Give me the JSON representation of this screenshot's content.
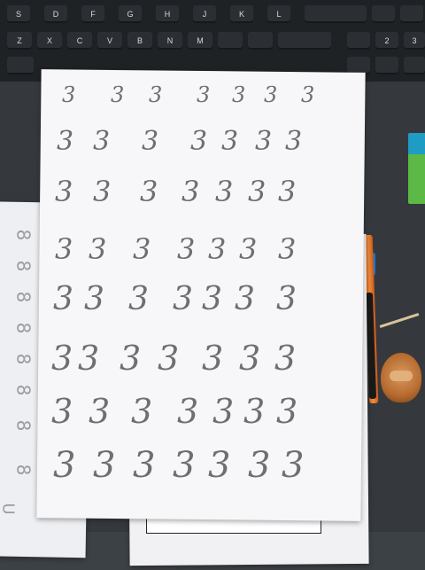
{
  "keyboard": {
    "row1": [
      "S",
      "D",
      "F",
      "G",
      "H",
      "J",
      "K",
      "L"
    ],
    "row2": [
      "Z",
      "X",
      "C",
      "V",
      "B",
      "N",
      "M"
    ],
    "numpad": [
      "2",
      "3"
    ]
  },
  "paper": {
    "digit": "3",
    "side_digit": "8",
    "side_letter": "U"
  }
}
